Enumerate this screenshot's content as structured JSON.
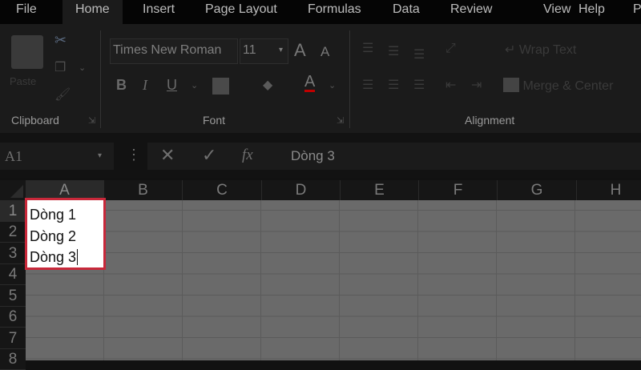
{
  "tabs": [
    "File",
    "Home",
    "Insert",
    "Page Layout",
    "Formulas",
    "Data",
    "Review",
    "View",
    "Help",
    "P"
  ],
  "active_tab": "Home",
  "ribbon": {
    "clipboard": {
      "label": "Clipboard",
      "paste": "Paste"
    },
    "font": {
      "label": "Font",
      "font_name": "Times New Roman",
      "font_size": "11",
      "bold": "B",
      "italic": "I",
      "underline": "U",
      "font_color_letter": "A",
      "grow": "A",
      "shrink": "A"
    },
    "alignment": {
      "label": "Alignment",
      "wrap_text": "Wrap Text",
      "merge_center": "Merge & Center"
    }
  },
  "formula_bar": {
    "name_box": "A1",
    "fx": "fx",
    "cancel": "✕",
    "enter": "✓",
    "content": "Dòng 3"
  },
  "columns": [
    "A",
    "B",
    "C",
    "D",
    "E",
    "F",
    "G",
    "H"
  ],
  "rows": [
    "1",
    "2",
    "3",
    "4",
    "5",
    "6",
    "7",
    "8"
  ],
  "edit_cell": {
    "lines": [
      "Dòng 1",
      "Dòng 2",
      "Dòng 3"
    ]
  },
  "colors": {
    "highlight": "#c8283a",
    "font_color": "#c00000"
  }
}
